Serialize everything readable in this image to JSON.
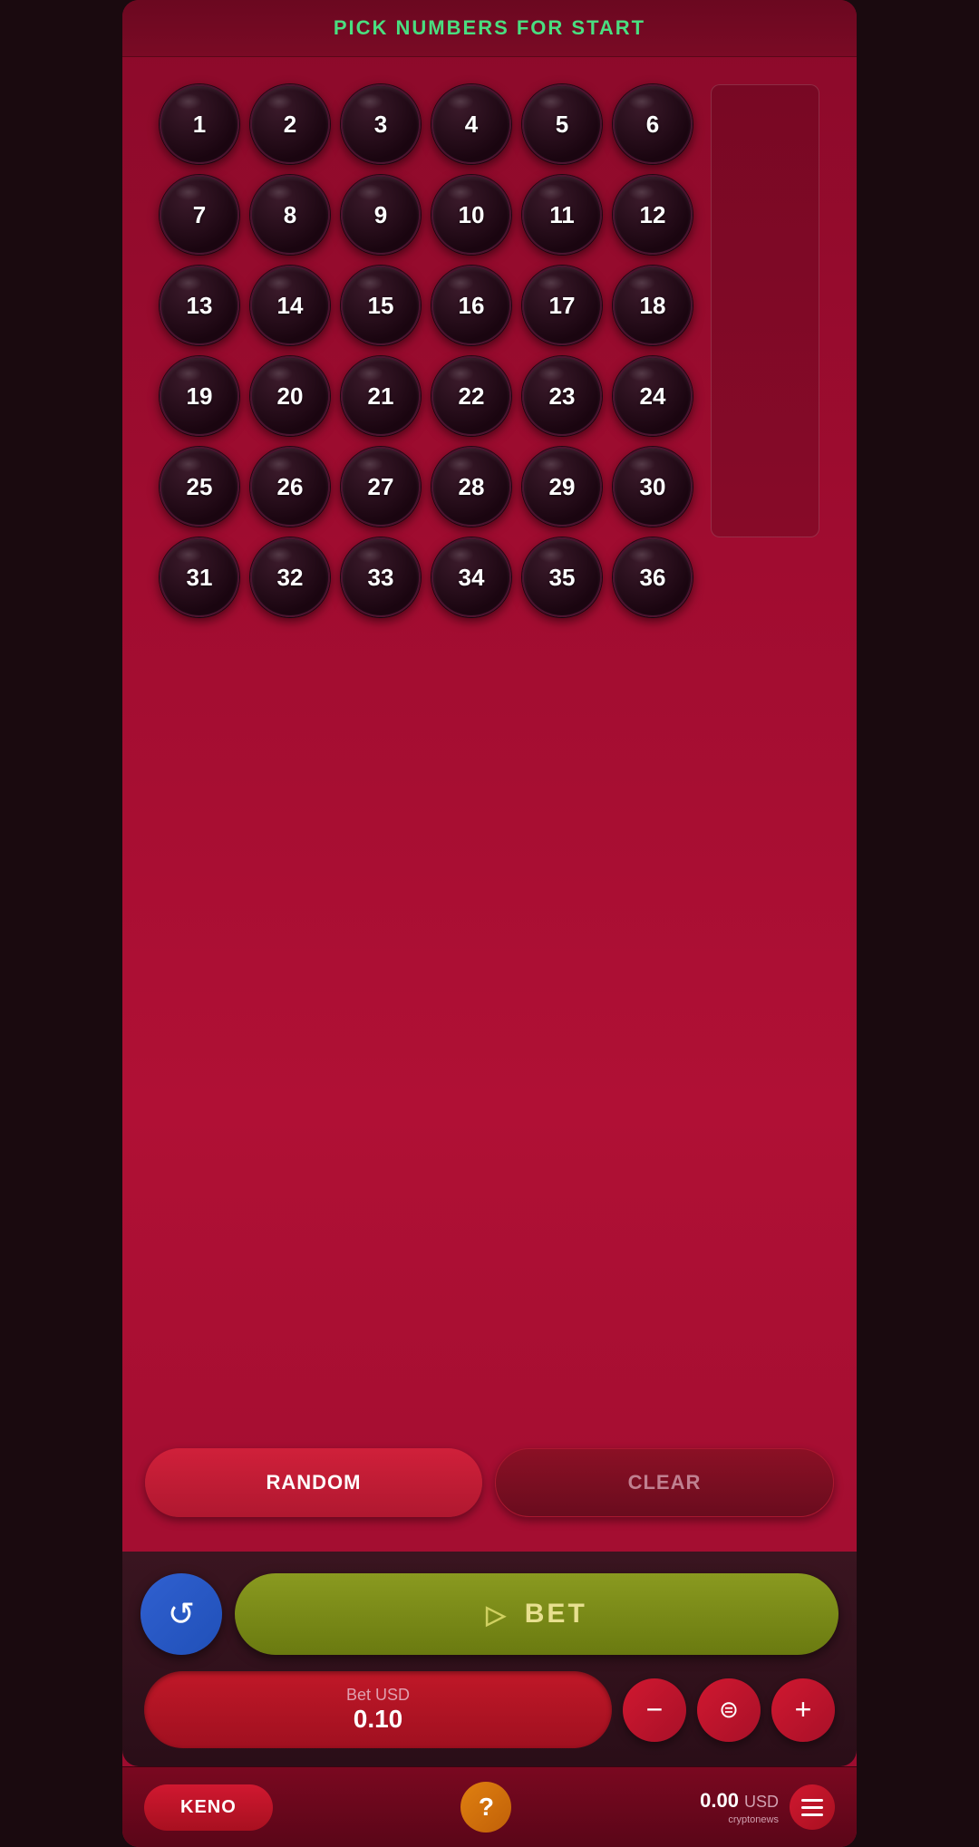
{
  "header": {
    "title": "PICK NUMBERS FOR START"
  },
  "grid": {
    "numbers": [
      1,
      2,
      3,
      4,
      5,
      6,
      7,
      8,
      9,
      10,
      11,
      12,
      13,
      14,
      15,
      16,
      17,
      18,
      19,
      20,
      21,
      22,
      23,
      24,
      25,
      26,
      27,
      28,
      29,
      30,
      31,
      32,
      33,
      34,
      35,
      36
    ]
  },
  "actions": {
    "random_label": "RANDOM",
    "clear_label": "CLEAR"
  },
  "bet": {
    "label": "Bet USD",
    "value": "0.10",
    "bet_button_label": "BET"
  },
  "nav": {
    "keno_label": "KENO",
    "balance": "0.00",
    "currency": "USD",
    "cryptonews": "cryptonews"
  }
}
